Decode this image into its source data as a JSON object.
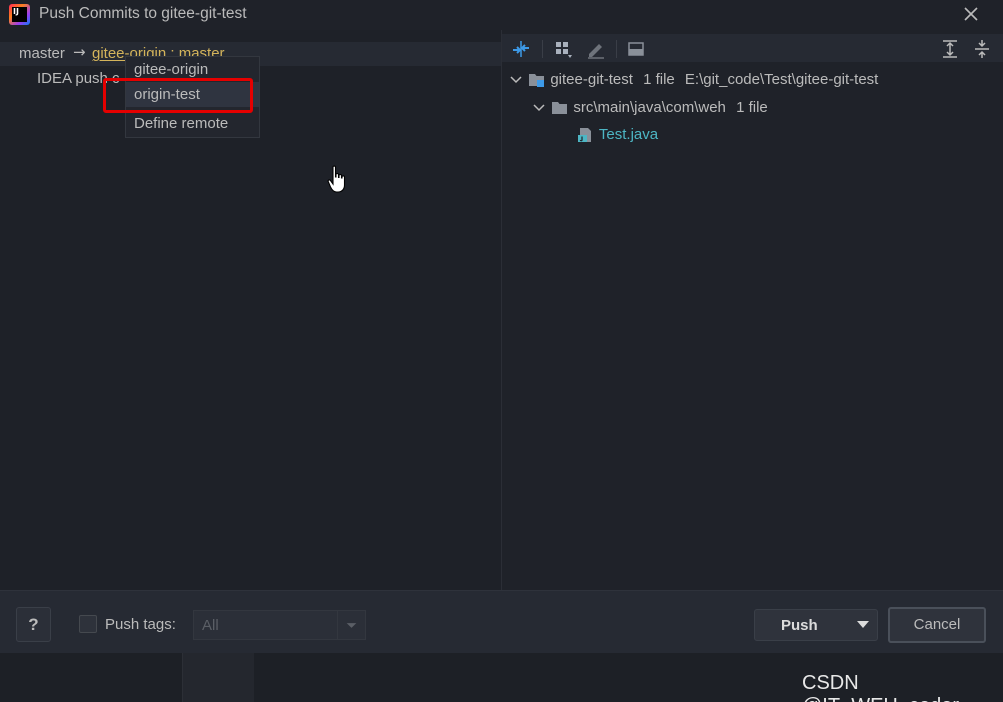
{
  "window": {
    "title": "Push Commits to gitee-git-test"
  },
  "push_tree": {
    "source_branch": "master",
    "arrow": "→",
    "target": "gitee-origin : master",
    "commit_text": "IDEA push c"
  },
  "remote_popup": {
    "items": [
      {
        "label": "gitee-origin",
        "selected": false
      },
      {
        "label": "origin-test",
        "selected": true
      },
      {
        "label": "Define remote",
        "selected": false
      }
    ]
  },
  "changes_tree": {
    "root": {
      "name": "gitee-git-test",
      "count": "1 file",
      "path": "E:\\git_code\\Test\\gitee-git-test"
    },
    "folder": {
      "name": "src\\main\\java\\com\\weh",
      "count": "1 file"
    },
    "file": {
      "name": "Test.java"
    }
  },
  "bottom": {
    "help_label": "?",
    "push_tags_label": "Push tags:",
    "push_tags_value": "All",
    "push_label": "Push",
    "cancel_label": "Cancel"
  },
  "watermark": "CSDN @IT_WEH_coder",
  "colors": {
    "accent_file": "#4db6c4",
    "target_branch": "#d4b45b",
    "highlight": "#e50000"
  }
}
